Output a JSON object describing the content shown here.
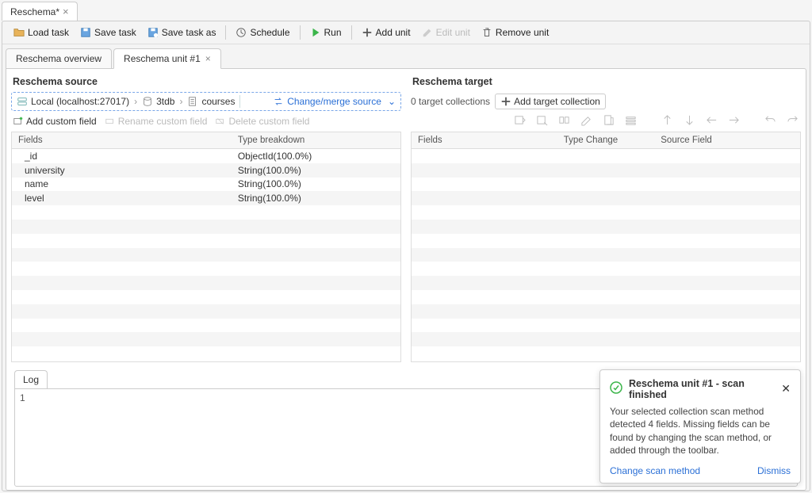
{
  "top_tab": {
    "label": "Reschema*"
  },
  "toolbar": {
    "load_task": "Load task",
    "save_task": "Save task",
    "save_task_as": "Save task as",
    "schedule": "Schedule",
    "run": "Run",
    "add_unit": "Add unit",
    "edit_unit": "Edit unit",
    "remove_unit": "Remove unit"
  },
  "subtabs": {
    "overview": "Reschema overview",
    "unit": "Reschema unit #1"
  },
  "source": {
    "heading": "Reschema source",
    "breadcrumb": {
      "connection": "Local (localhost:27017)",
      "database": "3tdb",
      "collection": "courses"
    },
    "change_merge": "Change/merge source",
    "add_custom": "Add custom field",
    "rename_custom": "Rename custom field",
    "delete_custom": "Delete custom field",
    "grid_headers": {
      "fields": "Fields",
      "type": "Type breakdown"
    },
    "rows": [
      {
        "field": "_id",
        "type": "ObjectId(100.0%)"
      },
      {
        "field": "university",
        "type": "String(100.0%)"
      },
      {
        "field": "name",
        "type": "String(100.0%)"
      },
      {
        "field": "level",
        "type": "String(100.0%)"
      }
    ]
  },
  "target": {
    "heading": "Reschema target",
    "count_label": "0 target collections",
    "add_target": "Add target collection",
    "grid_headers": {
      "fields": "Fields",
      "typechange": "Type Change",
      "sourcefield": "Source Field"
    }
  },
  "log": {
    "tab": "Log",
    "line1": "1"
  },
  "toast": {
    "title": "Reschema unit #1 - scan finished",
    "body": "Your selected collection scan method detected 4 fields. Missing fields can be found by changing the scan method, or added through the toolbar.",
    "change": "Change scan method",
    "dismiss": "Dismiss"
  }
}
